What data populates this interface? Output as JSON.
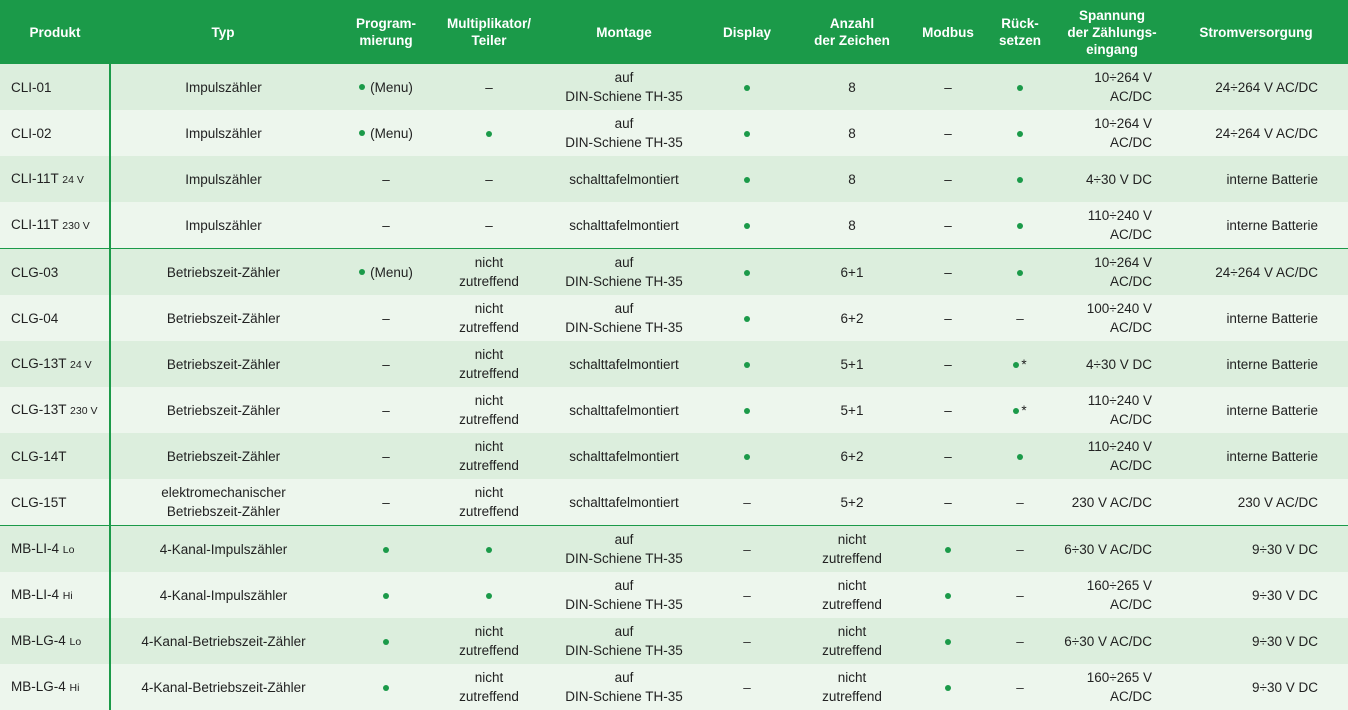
{
  "colors": {
    "header_bg": "#1b9a49",
    "row_dark": "#dceedd",
    "row_light": "#edf6ed",
    "dot": "#1b9a49"
  },
  "headers": {
    "produkt": "Produkt",
    "typ": "Typ",
    "programmierung": [
      "Program-",
      "mierung"
    ],
    "multiplikator": [
      "Multiplikator/",
      "Teiler"
    ],
    "montage": "Montage",
    "display": "Display",
    "zeichen": [
      "Anzahl",
      "der Zeichen"
    ],
    "modbus": "Modbus",
    "ruecksetzen": [
      "Rück-",
      "setzen"
    ],
    "spannung": [
      "Spannung",
      "der Zählungs-",
      "eingang"
    ],
    "strom": "Stromversorgung"
  },
  "rows": [
    {
      "produkt": "CLI-01",
      "suffix": "",
      "typ": [
        "Impulszähler"
      ],
      "prog": "dot-menu",
      "prog_text": "(Menu)",
      "mult": [
        "–"
      ],
      "montage": [
        "auf",
        "DIN-Schiene TH-35"
      ],
      "display": "dot",
      "zeichen": [
        "8"
      ],
      "modbus": "–",
      "reset": "dot",
      "spannung": "10÷264 V AC/DC",
      "strom": "24÷264 V AC/DC"
    },
    {
      "produkt": "CLI-02",
      "suffix": "",
      "typ": [
        "Impulszähler"
      ],
      "prog": "dot-menu",
      "prog_text": "(Menu)",
      "mult": [
        "dot"
      ],
      "montage": [
        "auf",
        "DIN-Schiene TH-35"
      ],
      "display": "dot",
      "zeichen": [
        "8"
      ],
      "modbus": "–",
      "reset": "dot",
      "spannung": "10÷264 V AC/DC",
      "strom": "24÷264 V AC/DC"
    },
    {
      "produkt": "CLI-11T",
      "suffix": "24 V",
      "typ": [
        "Impulszähler"
      ],
      "prog": "dash",
      "prog_text": "–",
      "mult": [
        "–"
      ],
      "montage": [
        "schalttafelmontiert"
      ],
      "display": "dot",
      "zeichen": [
        "8"
      ],
      "modbus": "–",
      "reset": "dot",
      "spannung": "4÷30 V DC",
      "strom": "interne Batterie"
    },
    {
      "produkt": "CLI-11T",
      "suffix": "230 V",
      "typ": [
        "Impulszähler"
      ],
      "prog": "dash",
      "prog_text": "–",
      "mult": [
        "–"
      ],
      "montage": [
        "schalttafelmontiert"
      ],
      "display": "dot",
      "zeichen": [
        "8"
      ],
      "modbus": "–",
      "reset": "dot",
      "spannung": "110÷240 V AC/DC",
      "strom": "interne Batterie"
    },
    {
      "produkt": "CLG-03",
      "suffix": "",
      "group_start": true,
      "typ": [
        "Betriebszeit-Zähler"
      ],
      "prog": "dot-menu",
      "prog_text": "(Menu)",
      "mult": [
        "nicht",
        "zutreffend"
      ],
      "montage": [
        "auf",
        "DIN-Schiene TH-35"
      ],
      "display": "dot",
      "zeichen": [
        "6+1"
      ],
      "modbus": "–",
      "reset": "dot",
      "spannung": "10÷264 V AC/DC",
      "strom": "24÷264 V AC/DC"
    },
    {
      "produkt": "CLG-04",
      "suffix": "",
      "typ": [
        "Betriebszeit-Zähler"
      ],
      "prog": "dash",
      "prog_text": "–",
      "mult": [
        "nicht",
        "zutreffend"
      ],
      "montage": [
        "auf",
        "DIN-Schiene TH-35"
      ],
      "display": "dot",
      "zeichen": [
        "6+2"
      ],
      "modbus": "–",
      "reset": "dash",
      "spannung": "100÷240 V AC/DC",
      "strom": "interne Batterie"
    },
    {
      "produkt": "CLG-13T",
      "suffix": "24 V",
      "typ": [
        "Betriebszeit-Zähler"
      ],
      "prog": "dash",
      "prog_text": "–",
      "mult": [
        "nicht",
        "zutreffend"
      ],
      "montage": [
        "schalttafelmontiert"
      ],
      "display": "dot",
      "zeichen": [
        "5+1"
      ],
      "modbus": "–",
      "reset": "dot-ast",
      "spannung": "4÷30 V DC",
      "strom": "interne Batterie"
    },
    {
      "produkt": "CLG-13T",
      "suffix": "230 V",
      "typ": [
        "Betriebszeit-Zähler"
      ],
      "prog": "dash",
      "prog_text": "–",
      "mult": [
        "nicht",
        "zutreffend"
      ],
      "montage": [
        "schalttafelmontiert"
      ],
      "display": "dot",
      "zeichen": [
        "5+1"
      ],
      "modbus": "–",
      "reset": "dot-ast",
      "spannung": "110÷240 V AC/DC",
      "strom": "interne Batterie"
    },
    {
      "produkt": "CLG-14T",
      "suffix": "",
      "typ": [
        "Betriebszeit-Zähler"
      ],
      "prog": "dash",
      "prog_text": "–",
      "mult": [
        "nicht",
        "zutreffend"
      ],
      "montage": [
        "schalttafelmontiert"
      ],
      "display": "dot",
      "zeichen": [
        "6+2"
      ],
      "modbus": "–",
      "reset": "dot",
      "spannung": "110÷240 V AC/DC",
      "strom": "interne Batterie"
    },
    {
      "produkt": "CLG-15T",
      "suffix": "",
      "typ": [
        "elektromechanischer",
        "Betriebszeit-Zähler"
      ],
      "prog": "dash",
      "prog_text": "–",
      "mult": [
        "nicht",
        "zutreffend"
      ],
      "montage": [
        "schalttafelmontiert"
      ],
      "display": "dash",
      "zeichen": [
        "5+2"
      ],
      "modbus": "–",
      "reset": "dash",
      "spannung": "230 V AC/DC",
      "strom": "230 V AC/DC"
    },
    {
      "produkt": "MB-LI-4",
      "suffix": "Lo",
      "group_start": true,
      "typ": [
        "4-Kanal-Impulszähler"
      ],
      "prog": "dot",
      "prog_text": "",
      "mult": [
        "dot"
      ],
      "montage": [
        "auf",
        "DIN-Schiene TH-35"
      ],
      "display": "dash",
      "zeichen": [
        "nicht",
        "zutreffend"
      ],
      "modbus": "dot",
      "reset": "dash",
      "spannung": "6÷30 V AC/DC",
      "strom": "9÷30 V DC"
    },
    {
      "produkt": "MB-LI-4",
      "suffix": "Hi",
      "typ": [
        "4-Kanal-Impulszähler"
      ],
      "prog": "dot",
      "prog_text": "",
      "mult": [
        "dot"
      ],
      "montage": [
        "auf",
        "DIN-Schiene TH-35"
      ],
      "display": "dash",
      "zeichen": [
        "nicht",
        "zutreffend"
      ],
      "modbus": "dot",
      "reset": "dash",
      "spannung": "160÷265 V AC/DC",
      "strom": "9÷30 V DC"
    },
    {
      "produkt": "MB-LG-4",
      "suffix": "Lo",
      "typ": [
        "4-Kanal-Betriebszeit-Zähler"
      ],
      "prog": "dot",
      "prog_text": "",
      "mult": [
        "nicht",
        "zutreffend"
      ],
      "montage": [
        "auf",
        "DIN-Schiene TH-35"
      ],
      "display": "dash",
      "zeichen": [
        "nicht",
        "zutreffend"
      ],
      "modbus": "dot",
      "reset": "dash",
      "spannung": "6÷30 V AC/DC",
      "strom": "9÷30 V DC"
    },
    {
      "produkt": "MB-LG-4",
      "suffix": "Hi",
      "typ": [
        "4-Kanal-Betriebszeit-Zähler"
      ],
      "prog": "dot",
      "prog_text": "",
      "mult": [
        "nicht",
        "zutreffend"
      ],
      "montage": [
        "auf",
        "DIN-Schiene TH-35"
      ],
      "display": "dash",
      "zeichen": [
        "nicht",
        "zutreffend"
      ],
      "modbus": "dot",
      "reset": "dash",
      "spannung": "160÷265 V AC/DC",
      "strom": "9÷30 V DC"
    }
  ]
}
